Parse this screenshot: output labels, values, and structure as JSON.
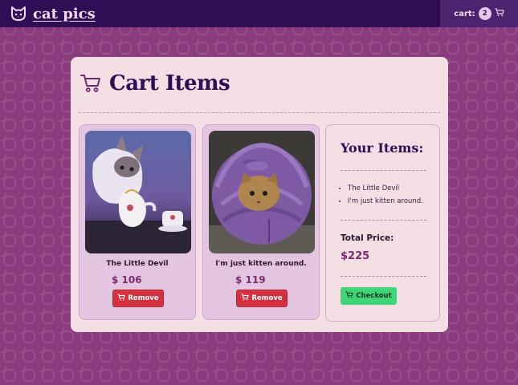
{
  "header": {
    "brand": "cat pics",
    "cart_label": "cart:",
    "cart_count": "2"
  },
  "main": {
    "title": "Cart Items",
    "items": [
      {
        "name": "The Little Devil",
        "price": "$ 106",
        "remove_label": "Remove"
      },
      {
        "name": "I'm just kitten around.",
        "price": "$ 119",
        "remove_label": "Remove"
      }
    ]
  },
  "summary": {
    "title": "Your Items:",
    "list": [
      "The Little Devil",
      "I'm just kitten around."
    ],
    "total_label": "Total Price:",
    "total_value": "$225",
    "checkout_label": "Checkout"
  },
  "colors": {
    "background": "#8b3a7e",
    "header": "#2e0e55",
    "remove": "#d3313f",
    "checkout": "#40d677"
  },
  "icons": [
    "cat-face-icon",
    "cart-icon"
  ]
}
